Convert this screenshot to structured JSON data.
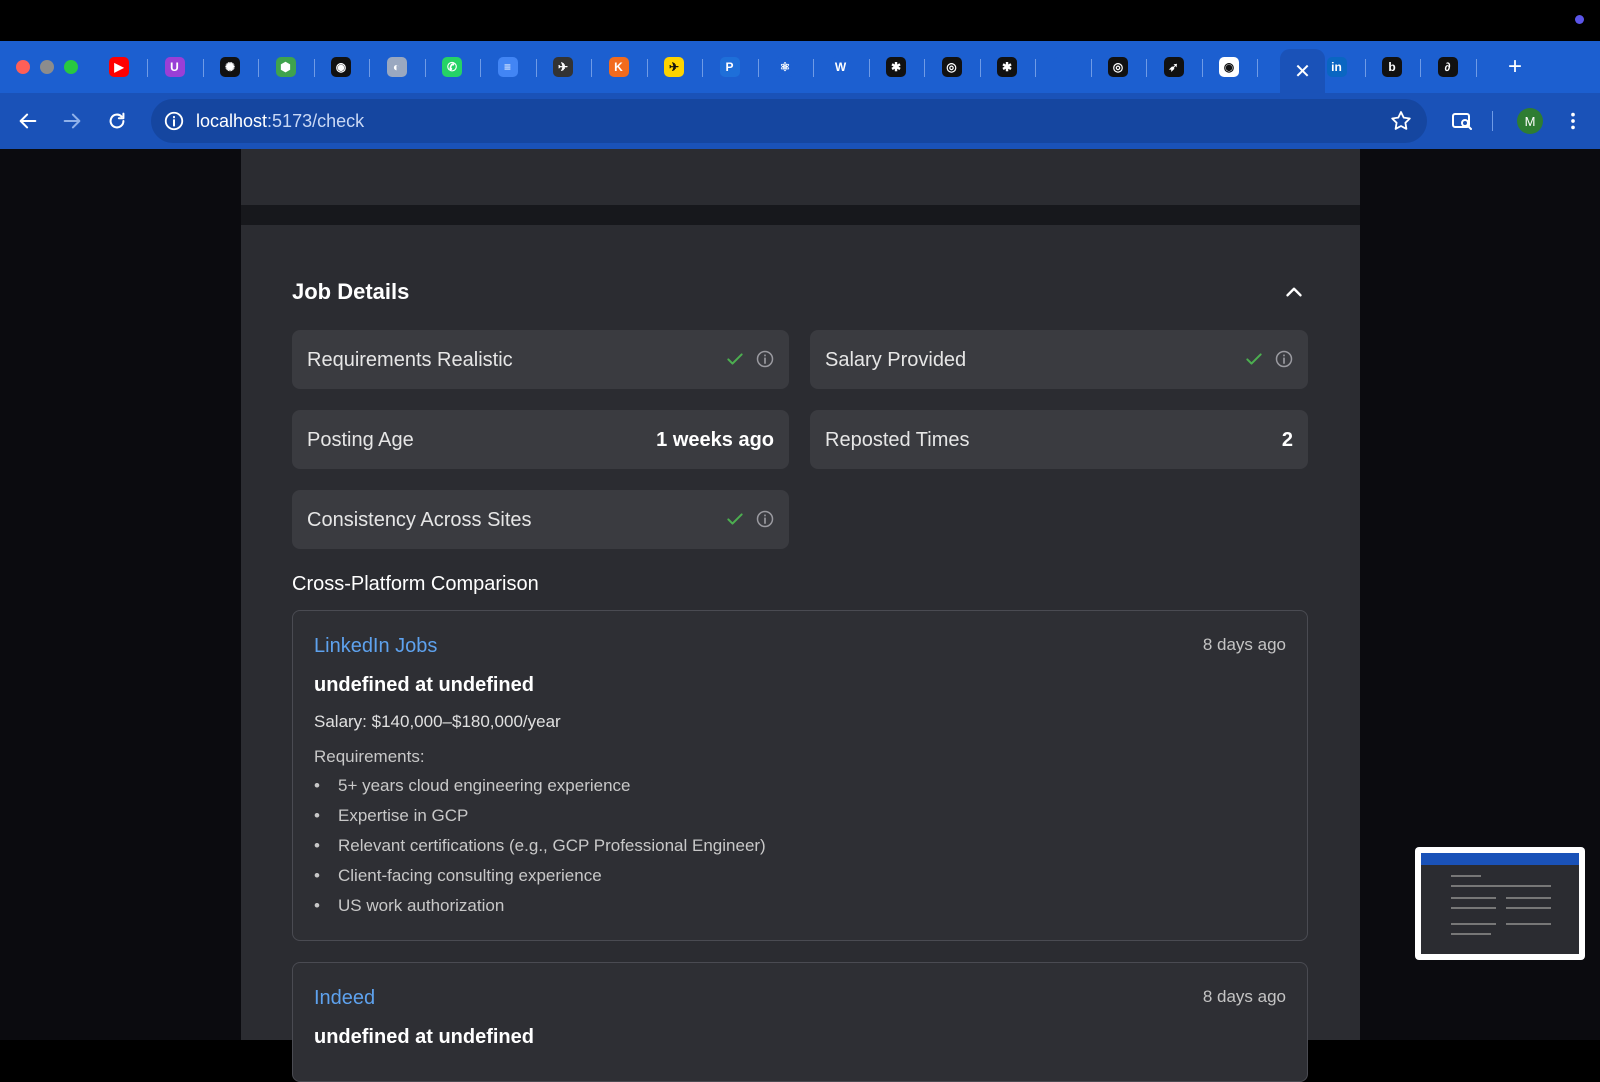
{
  "browser": {
    "url_host": "localhost",
    "url_path": ":5173/check",
    "profile_initial": "M",
    "tabs": [
      {
        "icon": "youtube-icon",
        "color": "#ff0000",
        "glyph": "▶"
      },
      {
        "icon": "ublock-icon",
        "color": "#9a3fd6",
        "glyph": "U"
      },
      {
        "icon": "openai-icon",
        "color": "#111111",
        "glyph": "✺"
      },
      {
        "icon": "cube-icon",
        "color": "#3fa34d",
        "glyph": "⬢"
      },
      {
        "icon": "github-icon",
        "color": "#111111",
        "glyph": "◉"
      },
      {
        "icon": "globe-icon",
        "color": "#9aa8c0",
        "glyph": "◐"
      },
      {
        "icon": "whatsapp-icon",
        "color": "#25d366",
        "glyph": "✆"
      },
      {
        "icon": "docs-icon",
        "color": "#4285f4",
        "glyph": "≡"
      },
      {
        "icon": "kayak-icon",
        "color": "#333333",
        "glyph": "✈"
      },
      {
        "icon": "k-icon",
        "color": "#f26b1d",
        "glyph": "K"
      },
      {
        "icon": "plane-icon",
        "color": "#ffd400",
        "glyph": "✈"
      },
      {
        "icon": "p-icon",
        "color": "#1e6fd9",
        "glyph": "P"
      },
      {
        "icon": "react-icon",
        "color": "#1c5fd0",
        "glyph": "⚛"
      },
      {
        "icon": "w-icon",
        "color": "#1c5fd0",
        "glyph": "W"
      },
      {
        "icon": "asterisk-icon",
        "color": "#111111",
        "glyph": "✱"
      },
      {
        "icon": "ring-icon",
        "color": "#111111",
        "glyph": "◎"
      },
      {
        "icon": "asterisk-icon",
        "color": "#111111",
        "glyph": "✱"
      },
      {
        "icon": "blank-icon",
        "color": "#1c5fd0",
        "glyph": ""
      },
      {
        "icon": "ring-icon",
        "color": "#111111",
        "glyph": "◎"
      },
      {
        "icon": "bird-icon",
        "color": "#111111",
        "glyph": "➶"
      },
      {
        "icon": "chrome-icon",
        "color": "#ffffff",
        "glyph": "◉"
      },
      {
        "icon": "linkedin-icon",
        "color": "#0a66c2",
        "glyph": "in"
      },
      {
        "icon": "b-icon",
        "color": "#111111",
        "glyph": "b"
      },
      {
        "icon": "swirl-icon",
        "color": "#111111",
        "glyph": "∂"
      }
    ]
  },
  "job_details": {
    "title": "Job Details",
    "cards": [
      {
        "label": "Requirements Realistic",
        "status": "check"
      },
      {
        "label": "Salary Provided",
        "status": "check"
      },
      {
        "label": "Posting Age",
        "value": "1 weeks ago"
      },
      {
        "label": "Reposted Times",
        "value": "2"
      },
      {
        "label": "Consistency Across Sites",
        "status": "check"
      }
    ]
  },
  "comparison": {
    "title": "Cross-Platform Comparison",
    "platforms": [
      {
        "name": "LinkedIn Jobs",
        "date": "8 days ago",
        "role": "undefined at undefined",
        "salary": "Salary: $140,000–$180,000/year",
        "requirements_title": "Requirements:",
        "requirements": [
          "5+ years cloud engineering experience",
          "Expertise in GCP",
          "Relevant certifications (e.g., GCP Professional Engineer)",
          "Client-facing consulting experience",
          "US work authorization"
        ]
      },
      {
        "name": "Indeed",
        "date": "8 days ago",
        "role": "undefined at undefined"
      }
    ]
  },
  "colors": {
    "accent": "#5ea2ee",
    "check": "#4caf50",
    "chrome_blue": "#1a52b8"
  }
}
